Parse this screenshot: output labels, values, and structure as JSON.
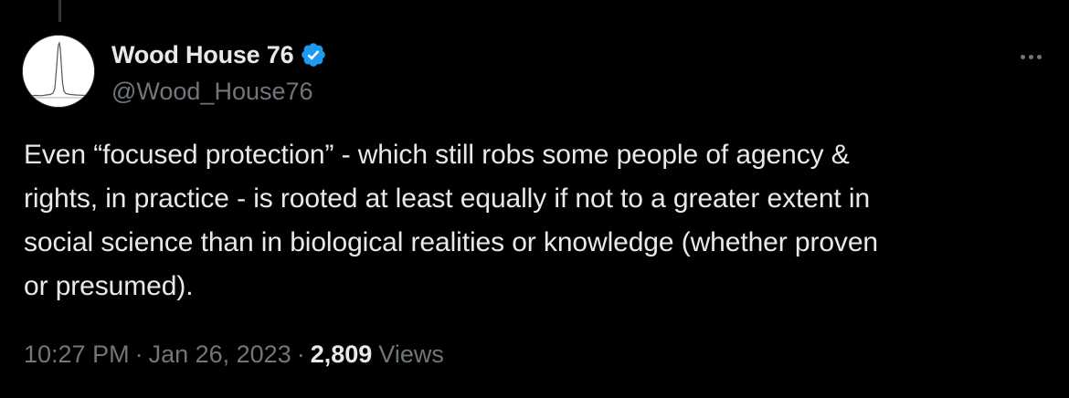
{
  "author": {
    "display_name": "Wood House 76",
    "handle": "@Wood_House76",
    "verified": true,
    "avatar_icon": "peak-graph-avatar-icon"
  },
  "tweet": {
    "text": "Even “focused protection” - which still robs some people of agency &\nrights, in practice - is rooted at least equally if not to a greater extent in\nsocial science than in biological realities or knowledge (whether proven\nor presumed).",
    "time": "10:27 PM",
    "date": "Jan 26, 2023",
    "separator": "·",
    "views_count": "2,809",
    "views_label": "Views"
  },
  "colors": {
    "background": "#000000",
    "primary_text": "#e7e9ea",
    "secondary_text": "#71767b",
    "verified_badge": "#1d9bf0"
  },
  "icons": {
    "more": "more-options-icon",
    "verified": "verified-badge-icon"
  }
}
